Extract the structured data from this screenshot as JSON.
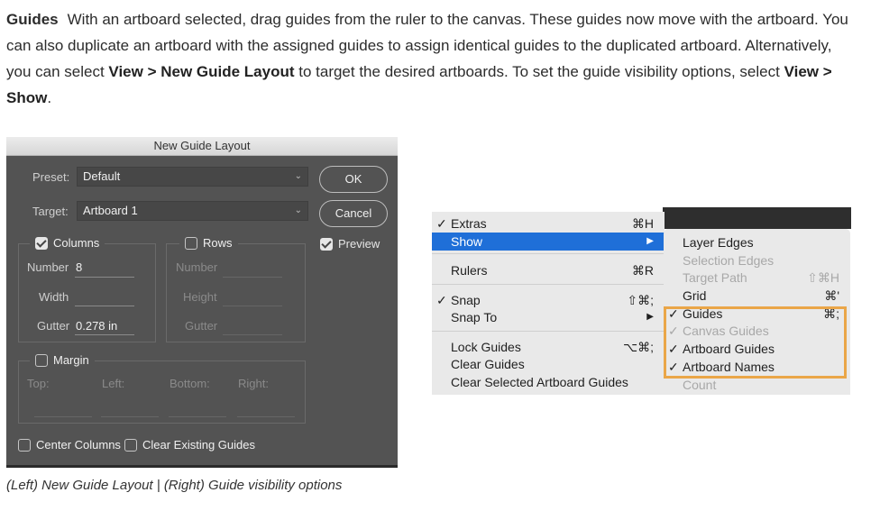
{
  "paragraph": {
    "lead": "Guides",
    "part1": "With an artboard selected, drag guides from the ruler to the canvas. These guides now move with the artboard. You can also duplicate an artboard with the assigned guides to assign identical guides to the duplicated artboard. Alternatively, you can select ",
    "view1": "View",
    "gt1": " > ",
    "new_guide_layout": "New Guide Layout",
    "part2": " to target the desired artboards. To set the guide visibility options, select ",
    "view2": "View",
    "gt2": " > ",
    "show": "Show",
    "end": "."
  },
  "dialog": {
    "title": "New Guide Layout",
    "preset_label": "Preset:",
    "preset_value": "Default",
    "target_label": "Target:",
    "target_value": "Artboard 1",
    "ok": "OK",
    "cancel": "Cancel",
    "preview": "Preview",
    "preview_checked": true,
    "columns": {
      "label": "Columns",
      "checked": true,
      "number_label": "Number",
      "number_value": "8",
      "width_label": "Width",
      "width_value": "",
      "gutter_label": "Gutter",
      "gutter_value": "0.278 in"
    },
    "rows": {
      "label": "Rows",
      "checked": false,
      "number_label": "Number",
      "height_label": "Height",
      "gutter_label": "Gutter"
    },
    "margin": {
      "label": "Margin",
      "checked": false,
      "top": "Top:",
      "left": "Left:",
      "bottom": "Bottom:",
      "right": "Right:"
    },
    "center_columns": "Center Columns",
    "clear_existing": "Clear Existing Guides"
  },
  "view_menu": [
    {
      "check": "✓",
      "label": "Extras",
      "shortcut": "⌘H"
    },
    {
      "check": "",
      "label": "Show",
      "shortcut": "▶",
      "selected": true
    },
    {
      "check": "",
      "label": "Rulers",
      "shortcut": "⌘R"
    },
    {
      "check": "✓",
      "label": "Snap",
      "shortcut": "⇧⌘;"
    },
    {
      "check": "",
      "label": "Snap To",
      "shortcut": "▶"
    },
    {
      "check": "",
      "label": "Lock Guides",
      "shortcut": "⌥⌘;"
    },
    {
      "check": "",
      "label": "Clear Guides",
      "shortcut": ""
    },
    {
      "check": "",
      "label": "Clear Selected Artboard Guides",
      "shortcut": ""
    }
  ],
  "show_submenu": [
    {
      "check": "",
      "label": "Layer Edges",
      "shortcut": "",
      "disabled": false
    },
    {
      "check": "",
      "label": "Selection Edges",
      "shortcut": "",
      "disabled": true
    },
    {
      "check": "",
      "label": "Target Path",
      "shortcut": "⇧⌘H",
      "disabled": true
    },
    {
      "check": "",
      "label": "Grid",
      "shortcut": "⌘'",
      "disabled": false
    },
    {
      "check": "✓",
      "label": "Guides",
      "shortcut": "⌘;",
      "disabled": false
    },
    {
      "check": "✓",
      "label": "Canvas Guides",
      "shortcut": "",
      "disabled": true
    },
    {
      "check": "✓",
      "label": "Artboard Guides",
      "shortcut": "",
      "disabled": false
    },
    {
      "check": "✓",
      "label": "Artboard Names",
      "shortcut": "",
      "disabled": false
    },
    {
      "check": "",
      "label": "Count",
      "shortcut": "",
      "disabled": true
    }
  ],
  "caption": "(Left) New Guide Layout | (Right) Guide visibility options",
  "colors": {
    "menu_selection": "#1f6fd8",
    "highlight_box": "#eaa648",
    "dialog_bg": "#535353"
  }
}
